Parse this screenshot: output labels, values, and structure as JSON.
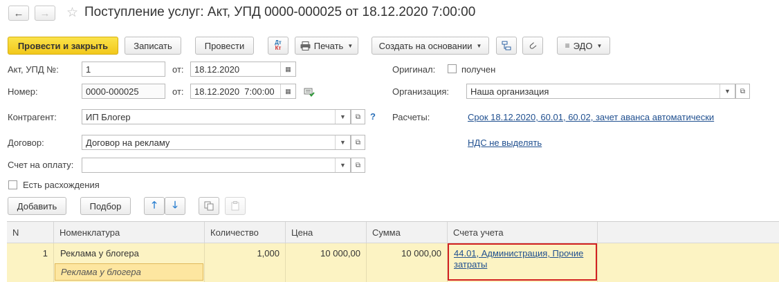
{
  "window": {
    "title": "Поступление услуг: Акт, УПД 0000-000025 от 18.12.2020 7:00:00",
    "back_icon": "←",
    "forward_icon": "→",
    "star_icon": "☆"
  },
  "toolbar": {
    "post_close": "Провести и закрыть",
    "save": "Записать",
    "post": "Провести",
    "dt_kt_top": "Дт",
    "dt_kt_bottom": "Кт",
    "print": "Печать",
    "create_based": "Создать на основании",
    "edo": "ЭДО"
  },
  "form": {
    "act_label": "Акт, УПД №:",
    "act_value": "1",
    "act_from_label": "от:",
    "act_date": "18.12.2020",
    "number_label": "Номер:",
    "number_value": "0000-000025",
    "number_from_label": "от:",
    "number_datetime": "18.12.2020  7:00:00",
    "original_label": "Оригинал:",
    "original_checkbox_label": "получен",
    "organization_label": "Организация:",
    "organization_value": "Наша организация",
    "counterparty_label": "Контрагент:",
    "counterparty_value": "ИП Блогер",
    "help_mark": "?",
    "settlements_label": "Расчеты:",
    "settlements_link": "Срок 18.12.2020, 60.01, 60.02, зачет аванса автоматически",
    "contract_label": "Договор:",
    "contract_value": "Договор на рекламу",
    "vat_link": "НДС не выделять",
    "invoice_label": "Счет на оплату:",
    "invoice_value": "",
    "discrepancy_label": "Есть расхождения"
  },
  "table_toolbar": {
    "add": "Добавить",
    "select": "Подбор"
  },
  "table": {
    "columns": [
      "N",
      "Номенклатура",
      "Количество",
      "Цена",
      "Сумма",
      "Счета учета"
    ],
    "rows": [
      {
        "n": "1",
        "item": "Реклама у блогера",
        "item_content": "Реклама у блогера",
        "quantity": "1,000",
        "price": "10 000,00",
        "sum": "10 000,00",
        "accounts": "44.01, Администрация, Прочие затраты"
      }
    ]
  },
  "colors": {
    "primary_button": "#f5d024",
    "link": "#1f4f8f",
    "selected_row": "#fcf3c3",
    "highlight_border": "#d22020"
  }
}
